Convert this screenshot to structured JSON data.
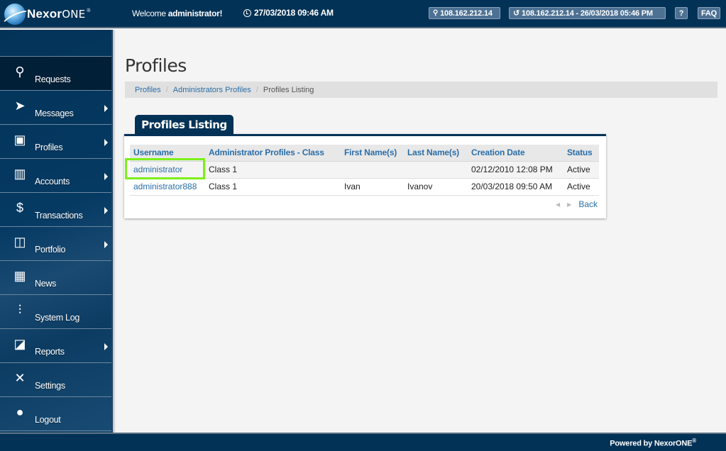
{
  "header": {
    "logo_bold": "Nexor",
    "logo_light": "ONE",
    "logo_mark": "®",
    "welcome_prefix": "Welcome ",
    "welcome_user": "administrator!",
    "datetime": "27/03/2018 09:46 AM",
    "ip_label": "108.162.212.14",
    "last_login_label": "108.162.212.14 - 26/03/2018 05:46 PM",
    "help_label": "?",
    "faq_label": "FAQ"
  },
  "sidebar": {
    "items": [
      {
        "label": "Requests",
        "icon": "lamp-icon",
        "glyph": "⚲",
        "has_submenu": false,
        "active": true
      },
      {
        "label": "Messages",
        "icon": "paper-plane-icon",
        "glyph": "➤",
        "has_submenu": true,
        "active": false
      },
      {
        "label": "Profiles",
        "icon": "address-book-icon",
        "glyph": "▣",
        "has_submenu": true,
        "active": false
      },
      {
        "label": "Accounts",
        "icon": "binders-icon",
        "glyph": "▥",
        "has_submenu": true,
        "active": false
      },
      {
        "label": "Transactions",
        "icon": "money-bag-icon",
        "glyph": "$",
        "has_submenu": true,
        "active": false
      },
      {
        "label": "Portfolio",
        "icon": "briefcase-icon",
        "glyph": "◫",
        "has_submenu": true,
        "active": false
      },
      {
        "label": "News",
        "icon": "radio-icon",
        "glyph": "▦",
        "has_submenu": false,
        "active": false
      },
      {
        "label": "System Log",
        "icon": "sliders-icon",
        "glyph": "⫶",
        "has_submenu": false,
        "active": false
      },
      {
        "label": "Reports",
        "icon": "presentation-icon",
        "glyph": "◪",
        "has_submenu": true,
        "active": false
      },
      {
        "label": "Settings",
        "icon": "tools-icon",
        "glyph": "✕",
        "has_submenu": false,
        "active": false
      },
      {
        "label": "Logout",
        "icon": "unlock-icon",
        "glyph": "●",
        "has_submenu": false,
        "active": false
      }
    ]
  },
  "page": {
    "title": "Profiles",
    "breadcrumb": [
      "Profiles",
      "Administrators Profiles",
      "Profiles Listing"
    ],
    "tab_label": "Profiles Listing"
  },
  "table": {
    "columns": [
      "Username",
      "Administrator Profiles - Class",
      "First Name(s)",
      "Last Name(s)",
      "Creation Date",
      "Status"
    ],
    "rows": [
      [
        "administrator",
        "Class 1",
        "",
        "",
        "02/12/2010 12:08 PM",
        "Active"
      ],
      [
        "administrator888",
        "Class 1",
        "Ivan",
        "Ivanov",
        "20/03/2018 09:50 AM",
        "Active"
      ]
    ]
  },
  "pager": {
    "prev": "◀",
    "next": "▶",
    "back_label": "Back"
  },
  "footer": {
    "text": "Powered by NexorONE",
    "mark": "®"
  },
  "colors": {
    "brand_navy": "#033257",
    "link_blue": "#2b6ea8",
    "highlight_green": "#7cf019"
  }
}
